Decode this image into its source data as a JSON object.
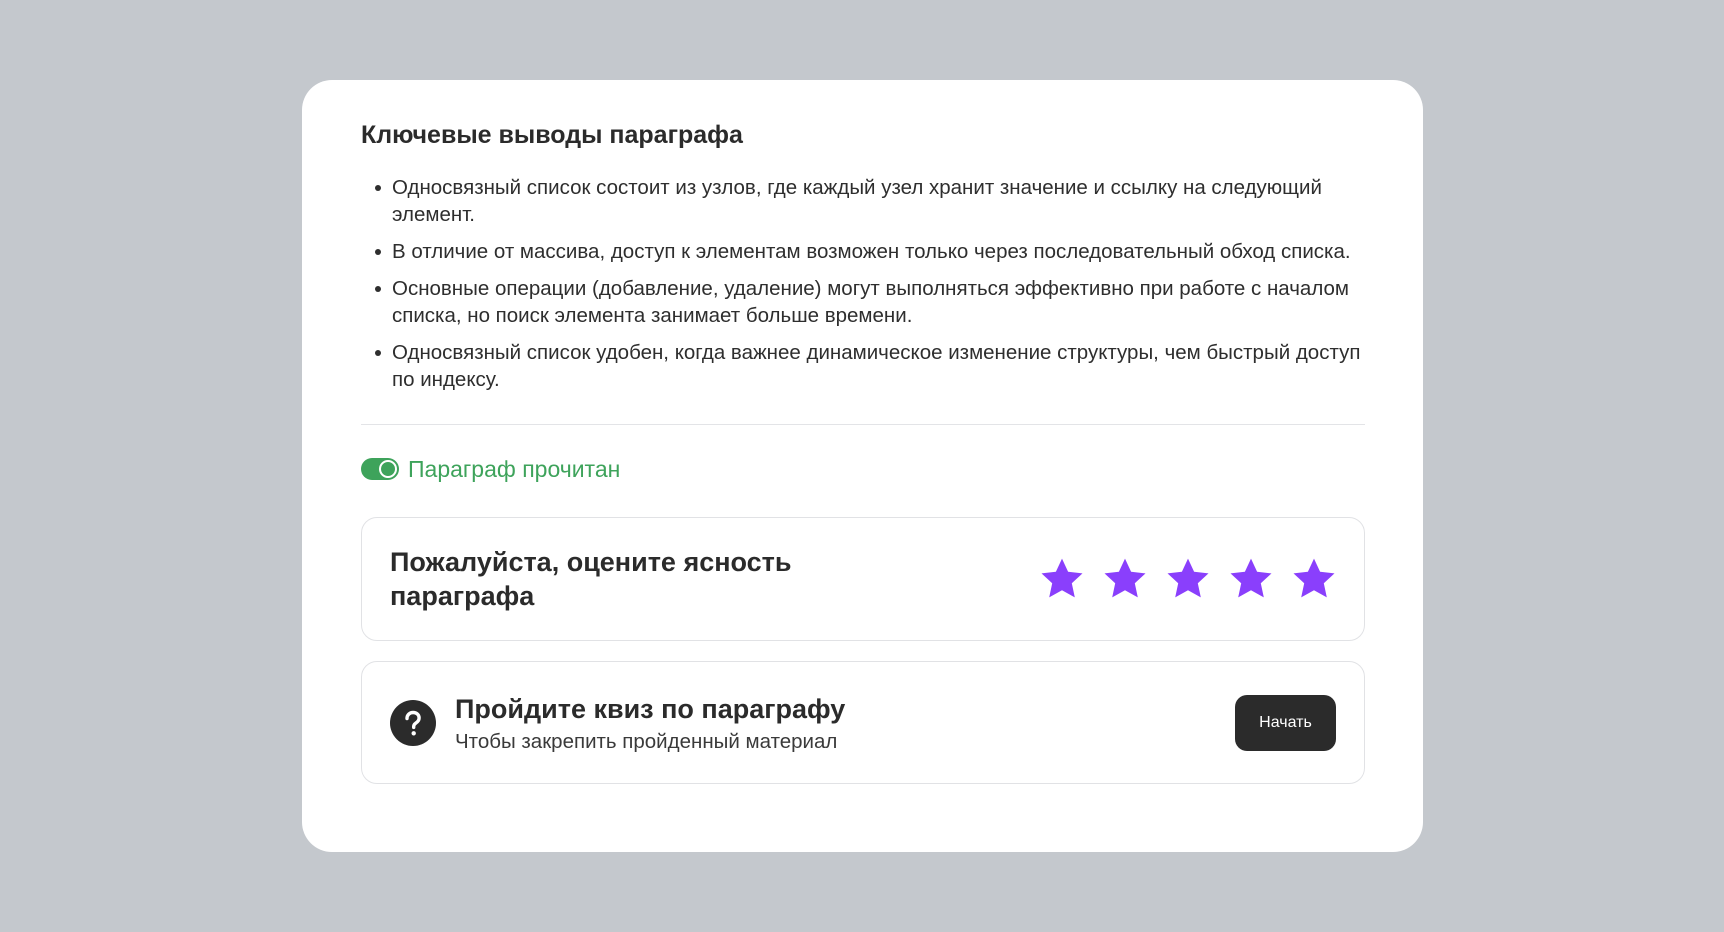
{
  "summary": {
    "title": "Ключевые выводы параграфа",
    "points": [
      "Односвязный список состоит из узлов, где каждый узел хранит значение и ссылку на следующий элемент.",
      "В отличие от массива, доступ к элементам возможен только через последовательный обход списка.",
      "Основные операции (добавление, удаление) могут выполняться эффективно при работе с началом списка, но поиск элемента занимает больше времени.",
      "Односвязный список удобен, когда важнее динамическое изменение структуры, чем быстрый доступ по индексу."
    ]
  },
  "read_status": {
    "label": "Параграф прочитан",
    "toggle_on": true,
    "color": "#3ea35b"
  },
  "rating": {
    "prompt": "Пожалуйста, оцените ясность параграфа",
    "stars_total": 5,
    "star_color": "#8a3ffc",
    "star_icon": "star-icon"
  },
  "quiz": {
    "icon": "question-icon",
    "title": "Пройдите квиз по параграфу",
    "subtitle": "Чтобы закрепить пройденный материал",
    "button_label": "Начать"
  },
  "colors": {
    "background": "#c4c8cd",
    "card": "#ffffff",
    "text_dark": "#2b2b2b"
  }
}
